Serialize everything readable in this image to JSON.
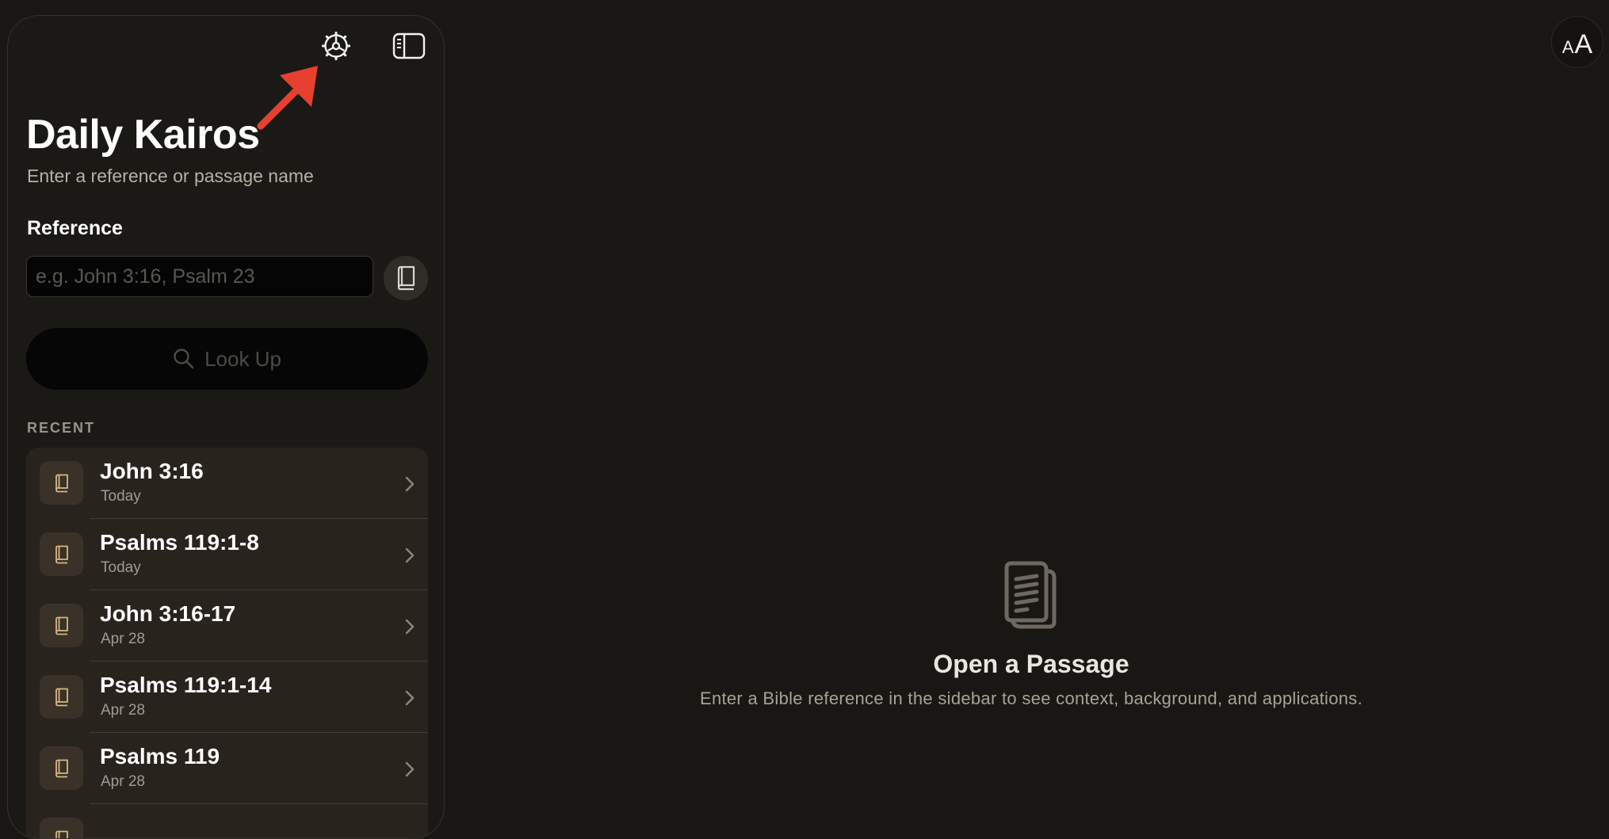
{
  "sidebar": {
    "app_title": "Daily Kairos",
    "subtitle": "Enter a reference or passage name",
    "reference_label": "Reference",
    "reference_input": {
      "value": "",
      "placeholder": "e.g. John 3:16, Psalm 23"
    },
    "lookup_label": "Look Up",
    "recent_header": "RECENT",
    "recent": [
      {
        "title": "John 3:16",
        "date": "Today"
      },
      {
        "title": "Psalms 119:1-8",
        "date": "Today"
      },
      {
        "title": "John 3:16-17",
        "date": "Apr 28"
      },
      {
        "title": "Psalms 119:1-14",
        "date": "Apr 28"
      },
      {
        "title": "Psalms 119",
        "date": "Apr 28"
      },
      {
        "title": "",
        "date": ""
      }
    ],
    "icons": {
      "settings": "gear-icon",
      "toggle": "sidebar-toggle-icon",
      "book": "book-icon"
    }
  },
  "toolbar": {
    "font_size_small": "A",
    "font_size_big": "A"
  },
  "empty_state": {
    "title": "Open a Passage",
    "text": "Enter a Bible reference in the sidebar to see context, background, and applications."
  },
  "colors": {
    "background": "#191714",
    "sidebar": "#1b1916",
    "accent_icon": "#d8b883",
    "annotation_arrow": "#e8402e"
  }
}
